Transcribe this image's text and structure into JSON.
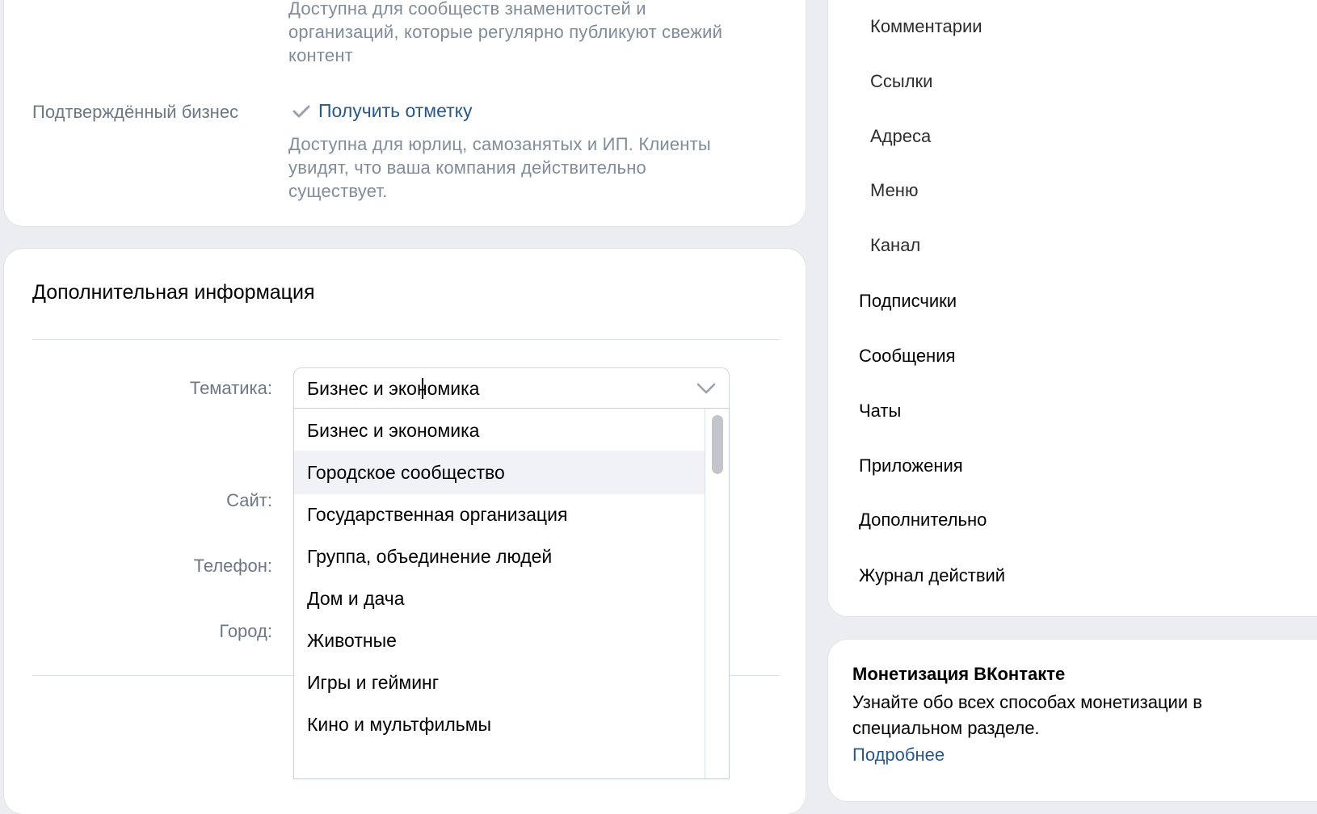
{
  "verification": {
    "top_description": "Доступна для сообществ знаменитостей и организаций, которые регулярно публикуют свежий контент",
    "business_label": "Подтверждённый бизнес",
    "get_mark_label": "Получить отметку",
    "business_description": "Доступна для юрлиц, самозанятых и ИП. Клиенты увидят, что ваша компания действительно существует."
  },
  "additional_info": {
    "title": "Дополнительная информация",
    "labels": {
      "topic": "Тематика:",
      "site": "Сайт:",
      "phone": "Телефон:",
      "city": "Город:"
    },
    "topic_select": {
      "value": "Бизнес и экономика",
      "options": [
        "Бизнес и экономика",
        "Городское сообщество",
        "Государственная организация",
        "Группа, объединение людей",
        "Дом и дача",
        "Животные",
        "Игры и гейминг",
        "Кино и мультфильмы"
      ],
      "hovered_option": "Городское сообщество"
    }
  },
  "sidebar_menu": {
    "sub_items": [
      "Комментарии",
      "Ссылки",
      "Адреса",
      "Меню",
      "Канал"
    ],
    "items": [
      "Подписчики",
      "Сообщения",
      "Чаты",
      "Приложения",
      "Дополнительно",
      "Журнал действий"
    ]
  },
  "monetization": {
    "title": "Монетизация ВКонтакте",
    "text": "Узнайте обо всех способах монетизации в специальном разделе.",
    "link": "Подробнее"
  },
  "colors": {
    "page_bg": "#ebedf0",
    "link": "#2a5885",
    "secondary_text": "#818c99",
    "label": "#6d7885"
  }
}
